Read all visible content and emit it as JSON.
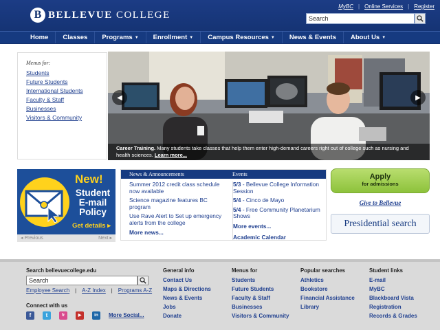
{
  "header": {
    "logo_b": "B",
    "logo_word1": "BELLEVUE",
    "logo_word2": "COLLEGE",
    "toplinks": [
      "MyBC",
      "Online Services",
      "Register"
    ],
    "search_placeholder": "Search"
  },
  "nav": {
    "items": [
      {
        "label": "Home",
        "dropdown": false
      },
      {
        "label": "Classes",
        "dropdown": false
      },
      {
        "label": "Programs",
        "dropdown": true
      },
      {
        "label": "Enrollment",
        "dropdown": true
      },
      {
        "label": "Campus Resources",
        "dropdown": true
      },
      {
        "label": "News & Events",
        "dropdown": false
      },
      {
        "label": "About Us",
        "dropdown": true
      }
    ]
  },
  "menus": {
    "heading": "Menus for:",
    "items": [
      "Students",
      "Future Students",
      "International Students",
      "Faculty & Staff",
      "Businesses",
      "Visitors & Community"
    ]
  },
  "hero": {
    "caption_title": "Career Training.",
    "caption_text": "Many students take classes that help them enter high-demand careers right out of college such as nursing and health sciences.",
    "caption_link": "Learn more..."
  },
  "promo": {
    "new": "New!",
    "title": "Student E-mail Policy",
    "cta": "Get details",
    "prev": "Previous",
    "next": "Next"
  },
  "news": {
    "heading": "News & Announcements",
    "items": [
      "Summer 2012 credit class schedule now available",
      "Science magazine features BC program",
      "Use Rave Alert to Set up emergency alerts from the college"
    ],
    "more": "More news..."
  },
  "events": {
    "heading": "Events",
    "items": [
      {
        "date": "5/3",
        "text": "- Bellevue College Information Session"
      },
      {
        "date": "5/4",
        "text": "- Cinco de Mayo"
      },
      {
        "date": "5/4",
        "text": "- Free Community Planetarium Shows"
      }
    ],
    "more": "More events...",
    "calendar": "Academic Calendar"
  },
  "sidebar_right": {
    "apply": "Apply",
    "apply_sub": "for admissions",
    "give": "Give to Bellevue",
    "presidential": "Presidential search"
  },
  "footer": {
    "search_heading": "Search bellevuecollege.edu",
    "search_placeholder": "Search",
    "search_links": [
      "Employee Search",
      "A-Z Index",
      "Programs A-Z"
    ],
    "connect_heading": "Connect with us",
    "social": [
      {
        "name": "facebook-icon",
        "glyph": "f",
        "color": "#3b5998"
      },
      {
        "name": "twitter-icon",
        "glyph": "t",
        "color": "#3aa3dd"
      },
      {
        "name": "flickr-icon",
        "glyph": "fr",
        "color": "#d94b8d"
      },
      {
        "name": "youtube-icon",
        "glyph": "▶",
        "color": "#c4302b"
      },
      {
        "name": "linkedin-icon",
        "glyph": "in",
        "color": "#1d67a8"
      }
    ],
    "more_social": "More Social...",
    "columns": [
      {
        "heading": "General info",
        "links": [
          "Contact Us",
          "Maps & Directions",
          "News & Events",
          "Jobs",
          "Donate"
        ]
      },
      {
        "heading": "Menus for",
        "links": [
          "Students",
          "Future Students",
          "Faculty & Staff",
          "Businesses",
          "Visitors & Community"
        ]
      },
      {
        "heading": "Popular searches",
        "links": [
          "Athletics",
          "Bookstore",
          "Financial Assistance",
          "Library"
        ]
      },
      {
        "heading": "Student links",
        "links": [
          "E-mail",
          "MyBC",
          "Blackboard Vista",
          "Registration",
          "Records & Grades"
        ]
      }
    ]
  },
  "colors": {
    "brand_blue": "#163a80",
    "apply_green": "#8dc23b",
    "promo_yellow": "#ffd21c"
  }
}
